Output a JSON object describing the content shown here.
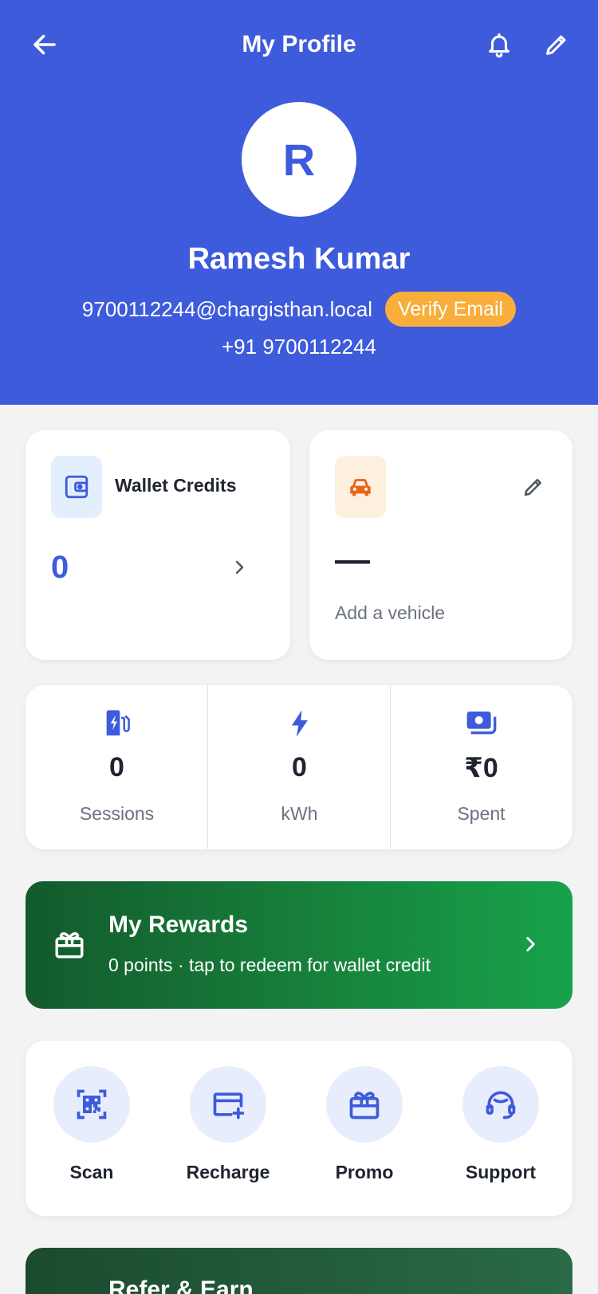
{
  "header": {
    "title": "My Profile",
    "avatar_initial": "R",
    "name": "Ramesh Kumar",
    "email": "9700112244@chargisthan.local",
    "verify_label": "Verify Email",
    "phone": "+91 9700112244",
    "icons": [
      "back-arrow-icon",
      "bell-icon",
      "pencil-icon"
    ],
    "colors": {
      "primary": "#3d5bdb",
      "verify_badge": "#f9ad3a"
    }
  },
  "wallet": {
    "title": "Wallet Credits",
    "value": "0",
    "icon": "wallet-icon"
  },
  "vehicle": {
    "value": "—",
    "subtitle": "Add a vehicle",
    "icon": "car-icon"
  },
  "stats": [
    {
      "value": "0",
      "label": "Sessions",
      "icon": "ev-station-icon"
    },
    {
      "value": "0",
      "label": "kWh",
      "icon": "bolt-icon"
    },
    {
      "value": "₹0",
      "label": "Spent",
      "icon": "cash-icon"
    }
  ],
  "rewards": {
    "title": "My Rewards",
    "subtitle": "0 points · tap to redeem for wallet credit",
    "icon": "gift-icon"
  },
  "quick_actions": [
    {
      "label": "Scan",
      "icon": "qr-scan-icon"
    },
    {
      "label": "Recharge",
      "icon": "card-add-icon"
    },
    {
      "label": "Promo",
      "icon": "gift-icon"
    },
    {
      "label": "Support",
      "icon": "headset-icon"
    }
  ],
  "refer": {
    "title": "Refer & Earn"
  }
}
